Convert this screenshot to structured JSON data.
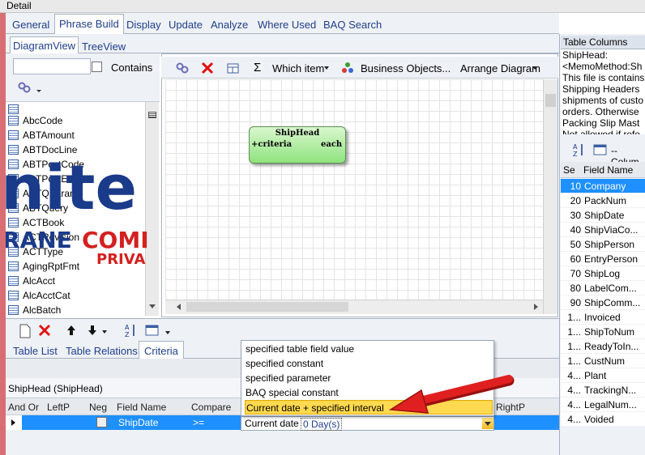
{
  "window": {
    "title": "Detail"
  },
  "tabs": [
    "General",
    "Phrase Build",
    "Display",
    "Update",
    "Analyze",
    "Where Used",
    "BAQ Search"
  ],
  "subtabs": [
    "DiagramView",
    "TreeView"
  ],
  "left_filter": {
    "search_value": "",
    "contains_label": "Contains"
  },
  "tables": [
    "AbcCode",
    "ABTAmount",
    "ABTDocLine",
    "ABTPostCode",
    "ABTPostEntity",
    "ABTQParam",
    "ABTQuery",
    "ACTBook",
    "ACTRevision",
    "ACTType",
    "AgingRptFmt",
    "AlcAcct",
    "AlcAcctCat",
    "AlcBatch"
  ],
  "diagram_toolbar": {
    "which_item": "Which item",
    "business_objects": "Business Objects...",
    "arrange": "Arrange Diagram"
  },
  "diagram_node": {
    "title": "ShipHead",
    "left": "+criteria",
    "right": "each"
  },
  "bottom_tabs": [
    "Table List",
    "Table Relations",
    "Criteria"
  ],
  "criteria": {
    "group": "ShipHead (ShipHead)",
    "headers": [
      "And Or",
      "LeftP",
      "Neg",
      "Field Name",
      "Compare",
      "RightP"
    ],
    "row": {
      "field": "ShipDate",
      "compare": ">=",
      "value_prefix": "Current date",
      "value_interval": "0 Day(s)"
    },
    "dropdown_options": [
      "specified table field value",
      "specified constant",
      "specified parameter",
      "BAQ special constant",
      "Current date + specified interval"
    ],
    "selected_option": 4
  },
  "right_panel": {
    "header": "Table Columns",
    "description": [
      "ShipHead:",
      "<MemoMethod:Sh",
      "This file is contains",
      "Shipping Headers",
      "shipments of custo",
      "orders. Otherwise",
      "Packing Slip Mast",
      "Not allowed if refe"
    ],
    "columns_dropdown": "--Colum",
    "col_headers": [
      "Se",
      "Field Name"
    ],
    "rows": [
      {
        "seq": "10",
        "name": "Company"
      },
      {
        "seq": "20",
        "name": "PackNum"
      },
      {
        "seq": "30",
        "name": "ShipDate"
      },
      {
        "seq": "40",
        "name": "ShipViaCo..."
      },
      {
        "seq": "50",
        "name": "ShipPerson"
      },
      {
        "seq": "60",
        "name": "EntryPerson"
      },
      {
        "seq": "70",
        "name": "ShipLog"
      },
      {
        "seq": "80",
        "name": "LabelCom..."
      },
      {
        "seq": "90",
        "name": "ShipComm..."
      },
      {
        "seq": "1...",
        "name": "Invoiced"
      },
      {
        "seq": "1...",
        "name": "ShipToNum"
      },
      {
        "seq": "1...",
        "name": "ReadyToIn..."
      },
      {
        "seq": "1...",
        "name": "CustNum"
      },
      {
        "seq": "4...",
        "name": "Plant"
      },
      {
        "seq": "4...",
        "name": "TrackingN..."
      },
      {
        "seq": "4...",
        "name": "LegalNum..."
      },
      {
        "seq": "4...",
        "name": "Voided"
      }
    ]
  },
  "colors": {
    "accent": "#1e90ff",
    "node_green": "#8fe37e",
    "highlight": "#ffd94f",
    "arrow": "#e02020"
  }
}
